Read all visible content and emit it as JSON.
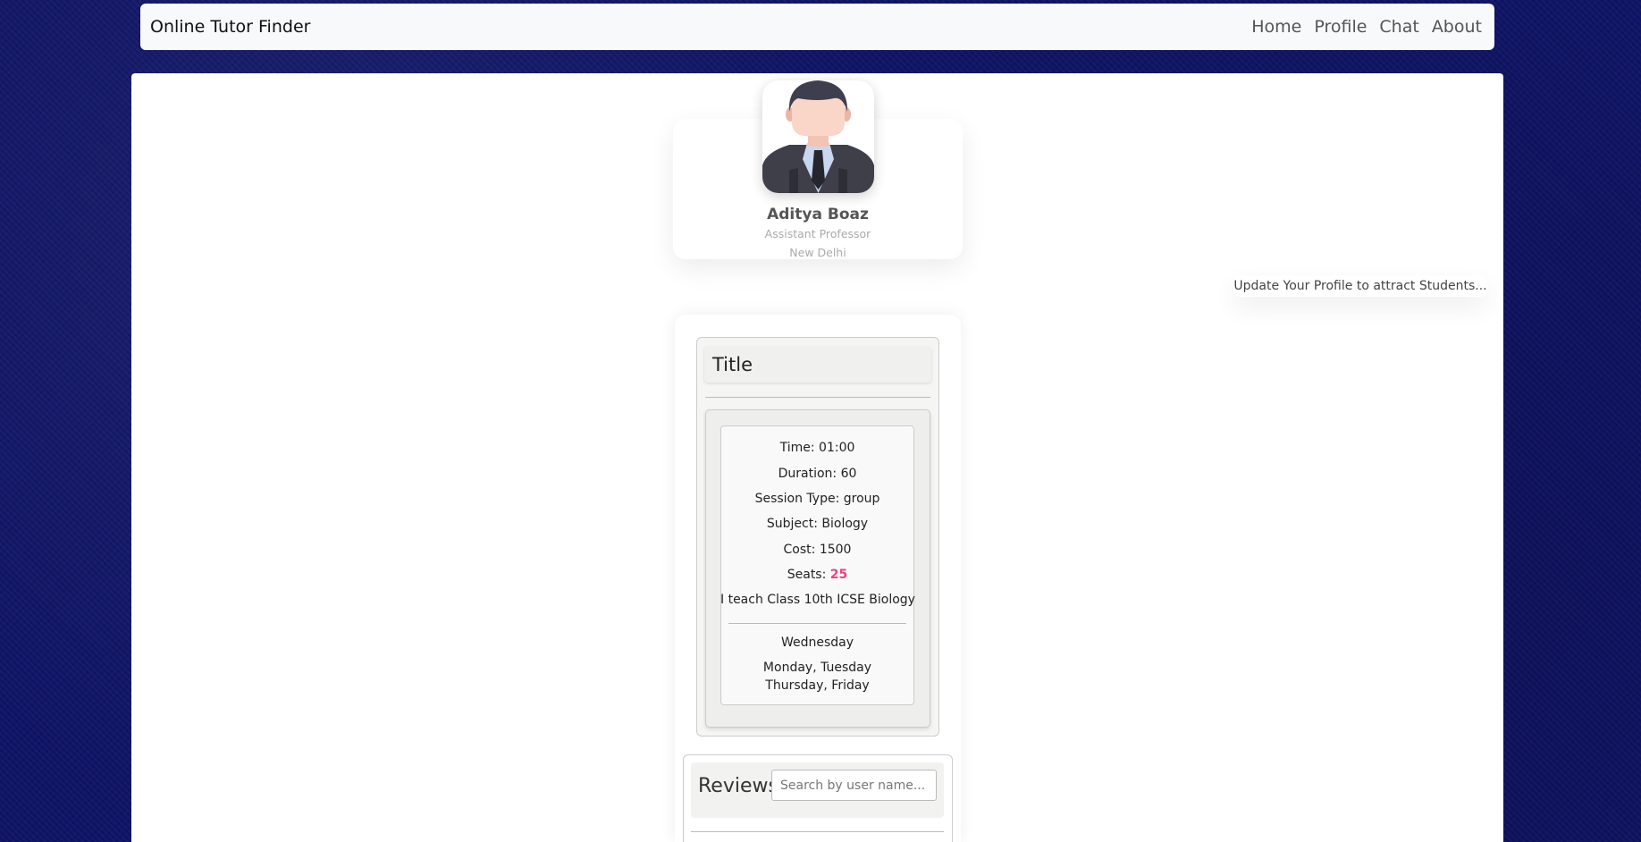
{
  "navbar": {
    "brand": "Online Tutor Finder",
    "links": [
      "Home",
      "Profile",
      "Chat",
      "About"
    ]
  },
  "profile": {
    "name": "Aditya Boaz",
    "role": "Assistant Professor",
    "city": "New Delhi",
    "avatar_icon": "person-avatar-icon"
  },
  "notice": "Update Your Profile to attract Students...",
  "session": {
    "title": "Title",
    "time_label": "Time: 01:00",
    "duration_label": "Duration: 60",
    "session_type_label": "Session Type: group",
    "subject_label": "Subject: Biology",
    "cost_label": "Cost: 1500",
    "seats_label": "Seats: ",
    "seats_value": "25",
    "description": "I teach Class 10th ICSE Biology",
    "day_primary": "Wednesday",
    "days_line1": "Monday, Tuesday",
    "days_line2": "Thursday, Friday"
  },
  "reviews": {
    "title": "Reviews",
    "search_placeholder": "Search by user name..."
  },
  "colors": {
    "background": "#0f1466",
    "seats_accent": "#e8457b"
  }
}
